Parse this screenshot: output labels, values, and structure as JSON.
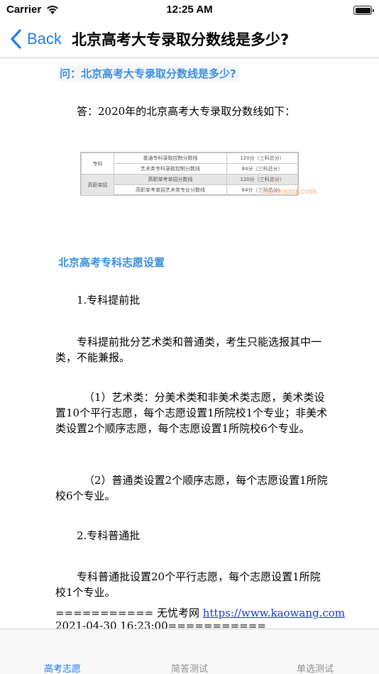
{
  "status_bar": {
    "carrier": "Carrier",
    "time": "12:25 AM"
  },
  "nav": {
    "back_label": "Back",
    "title": "北京高考大专录取分数线是多少?"
  },
  "article": {
    "question": "问：北京高考大专录取分数线是多少?",
    "answer_intro": "答：2020年的北京高考大专录取分数线如下：",
    "table": {
      "rows": [
        {
          "category": "专科",
          "item": "普通专科录取控制分数线",
          "value": "120分（三科总分）"
        },
        {
          "category": "",
          "item": "艺术类专科录取控制分数线",
          "value": "84分（三科总分）"
        },
        {
          "category": "高职单招",
          "item": "高职单考单招分数线",
          "value": "120分（三科总分）"
        },
        {
          "category": "",
          "item": "高职单考单招艺术类专业分数线",
          "value": "84分（三科总分）"
        }
      ],
      "watermark": "kaowang.com"
    },
    "section_heading": "北京高考专科志愿设置",
    "paragraphs": [
      "1.专科提前批",
      "专科提前批分艺术类和普通类，考生只能选报其中一类，不能兼报。",
      "（1）艺术类：分美术类和非美术类志愿，美术类设置10个平行志愿，每个志愿设置1所院校1个专业；非美术类设置2个顺序志愿，每个志愿设置1所院校6个专业。",
      "（2）普通类设置2个顺序志愿，每个志愿设置1所院校6个专业。",
      "2.专科普通批",
      "专科普通批设置20个平行志愿，每个志愿设置1所院校1个专业。"
    ],
    "footer_prefix": "=========== 无忧考网 ",
    "footer_link": "https://www.kaowang.com",
    "footer_date": "2021-04-30 16:23:00==========="
  },
  "tabs": [
    {
      "label": "高考志愿",
      "active": true
    },
    {
      "label": "简答测试",
      "active": false
    },
    {
      "label": "单选测试",
      "active": false
    }
  ],
  "colors": {
    "accent": "#1e7cf1",
    "heading": "#3b8fde",
    "link": "#1a38c4",
    "inactive_tab": "#8e8e93"
  }
}
